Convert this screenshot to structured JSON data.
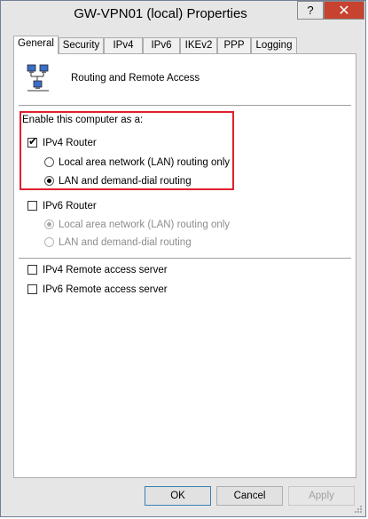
{
  "window": {
    "title": "GW-VPN01 (local) Properties",
    "help_glyph": "?",
    "close_glyph": "✕"
  },
  "tabs": [
    {
      "label": "General",
      "active": true
    },
    {
      "label": "Security"
    },
    {
      "label": "IPv4"
    },
    {
      "label": "IPv6"
    },
    {
      "label": "IKEv2"
    },
    {
      "label": "PPP"
    },
    {
      "label": "Logging"
    }
  ],
  "service": {
    "label": "Routing and Remote Access",
    "icon": "network-computers-icon"
  },
  "group": {
    "caption": "Enable this computer as a:",
    "ipv4_router": {
      "label": "IPv4 Router",
      "checked": true,
      "options": [
        {
          "label": "Local area network (LAN) routing only",
          "selected": false
        },
        {
          "label": "LAN and demand-dial routing",
          "selected": true
        }
      ]
    },
    "ipv6_router": {
      "label": "IPv6 Router",
      "checked": false,
      "options": [
        {
          "label": "Local area network (LAN) routing only",
          "selected": true,
          "disabled": true
        },
        {
          "label": "LAN and demand-dial routing",
          "selected": false,
          "disabled": true
        }
      ]
    },
    "ipv4_ras": {
      "label": "IPv4 Remote access server",
      "checked": false
    },
    "ipv6_ras": {
      "label": "IPv6 Remote access server",
      "checked": false
    }
  },
  "buttons": {
    "ok": "OK",
    "cancel": "Cancel",
    "apply": "Apply"
  },
  "colors": {
    "highlight": "#e0202f",
    "close_button": "#c7432f"
  }
}
